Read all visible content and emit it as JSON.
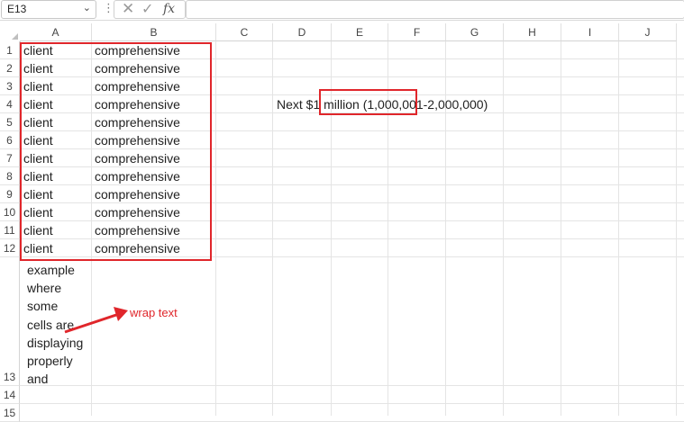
{
  "formula_bar": {
    "name_box": "E13",
    "cancel_icon": "✕",
    "enter_icon": "✓",
    "function_icon": "fx",
    "formula": ""
  },
  "columns": [
    "A",
    "B",
    "C",
    "D",
    "E",
    "F",
    "G",
    "H",
    "I",
    "J"
  ],
  "rows": [
    "1",
    "2",
    "3",
    "4",
    "5",
    "6",
    "7",
    "8",
    "9",
    "10",
    "11",
    "12",
    "13",
    "14",
    "15"
  ],
  "cells": {
    "a": [
      "client",
      "client",
      "client",
      "client",
      "client",
      "client",
      "client",
      "client",
      "client",
      "client",
      "client",
      "client"
    ],
    "b": [
      "comprehensive",
      "comprehensive",
      "comprehensive",
      "comprehensive",
      "comprehensive",
      "comprehensive",
      "comprehensive",
      "comprehensive",
      "comprehensive",
      "comprehensive",
      "comprehensive",
      "comprehensive"
    ],
    "d4": "Next $1 million (1,000,001-2,000,000)",
    "a13_lines": [
      "example",
      "where",
      "some",
      "cells are",
      "displaying",
      "properly",
      "and"
    ]
  },
  "annotation": {
    "label": "wrap text",
    "color": "#e0262b"
  }
}
